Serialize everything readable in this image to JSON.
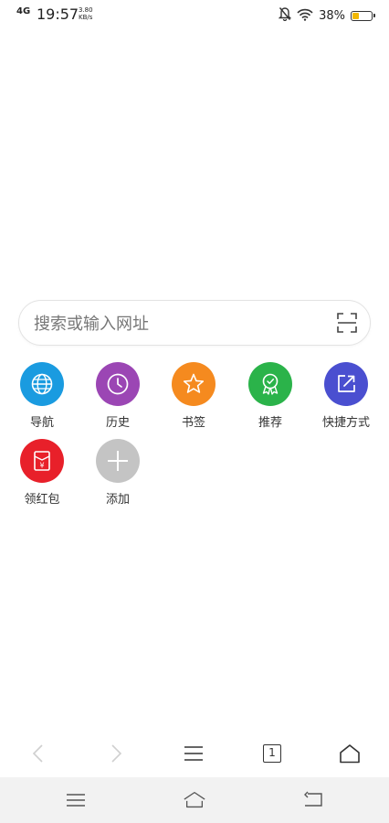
{
  "status_bar": {
    "network": "4G",
    "time": "19:57",
    "speed_value": "3.80",
    "speed_unit": "KB/s",
    "battery_pct": "38%",
    "battery_level": 0.38,
    "battery_color": "#f2b800"
  },
  "search": {
    "placeholder": "搜索或输入网址",
    "value": ""
  },
  "quick_links": [
    {
      "label": "导航",
      "icon": "globe-icon",
      "color": "#1a9be0"
    },
    {
      "label": "历史",
      "icon": "clock-icon",
      "color": "#9b46b4"
    },
    {
      "label": "书签",
      "icon": "star-icon",
      "color": "#f58a1f"
    },
    {
      "label": "推荐",
      "icon": "badge-icon",
      "color": "#2bb34a"
    },
    {
      "label": "快捷方式",
      "icon": "share-icon",
      "color": "#4a4fd0"
    },
    {
      "label": "领红包",
      "icon": "red-envelope-icon",
      "color": "#e8202a"
    },
    {
      "label": "添加",
      "icon": "plus-icon",
      "color": "#c4c4c4"
    }
  ],
  "toolbar": {
    "tab_count": "1"
  }
}
